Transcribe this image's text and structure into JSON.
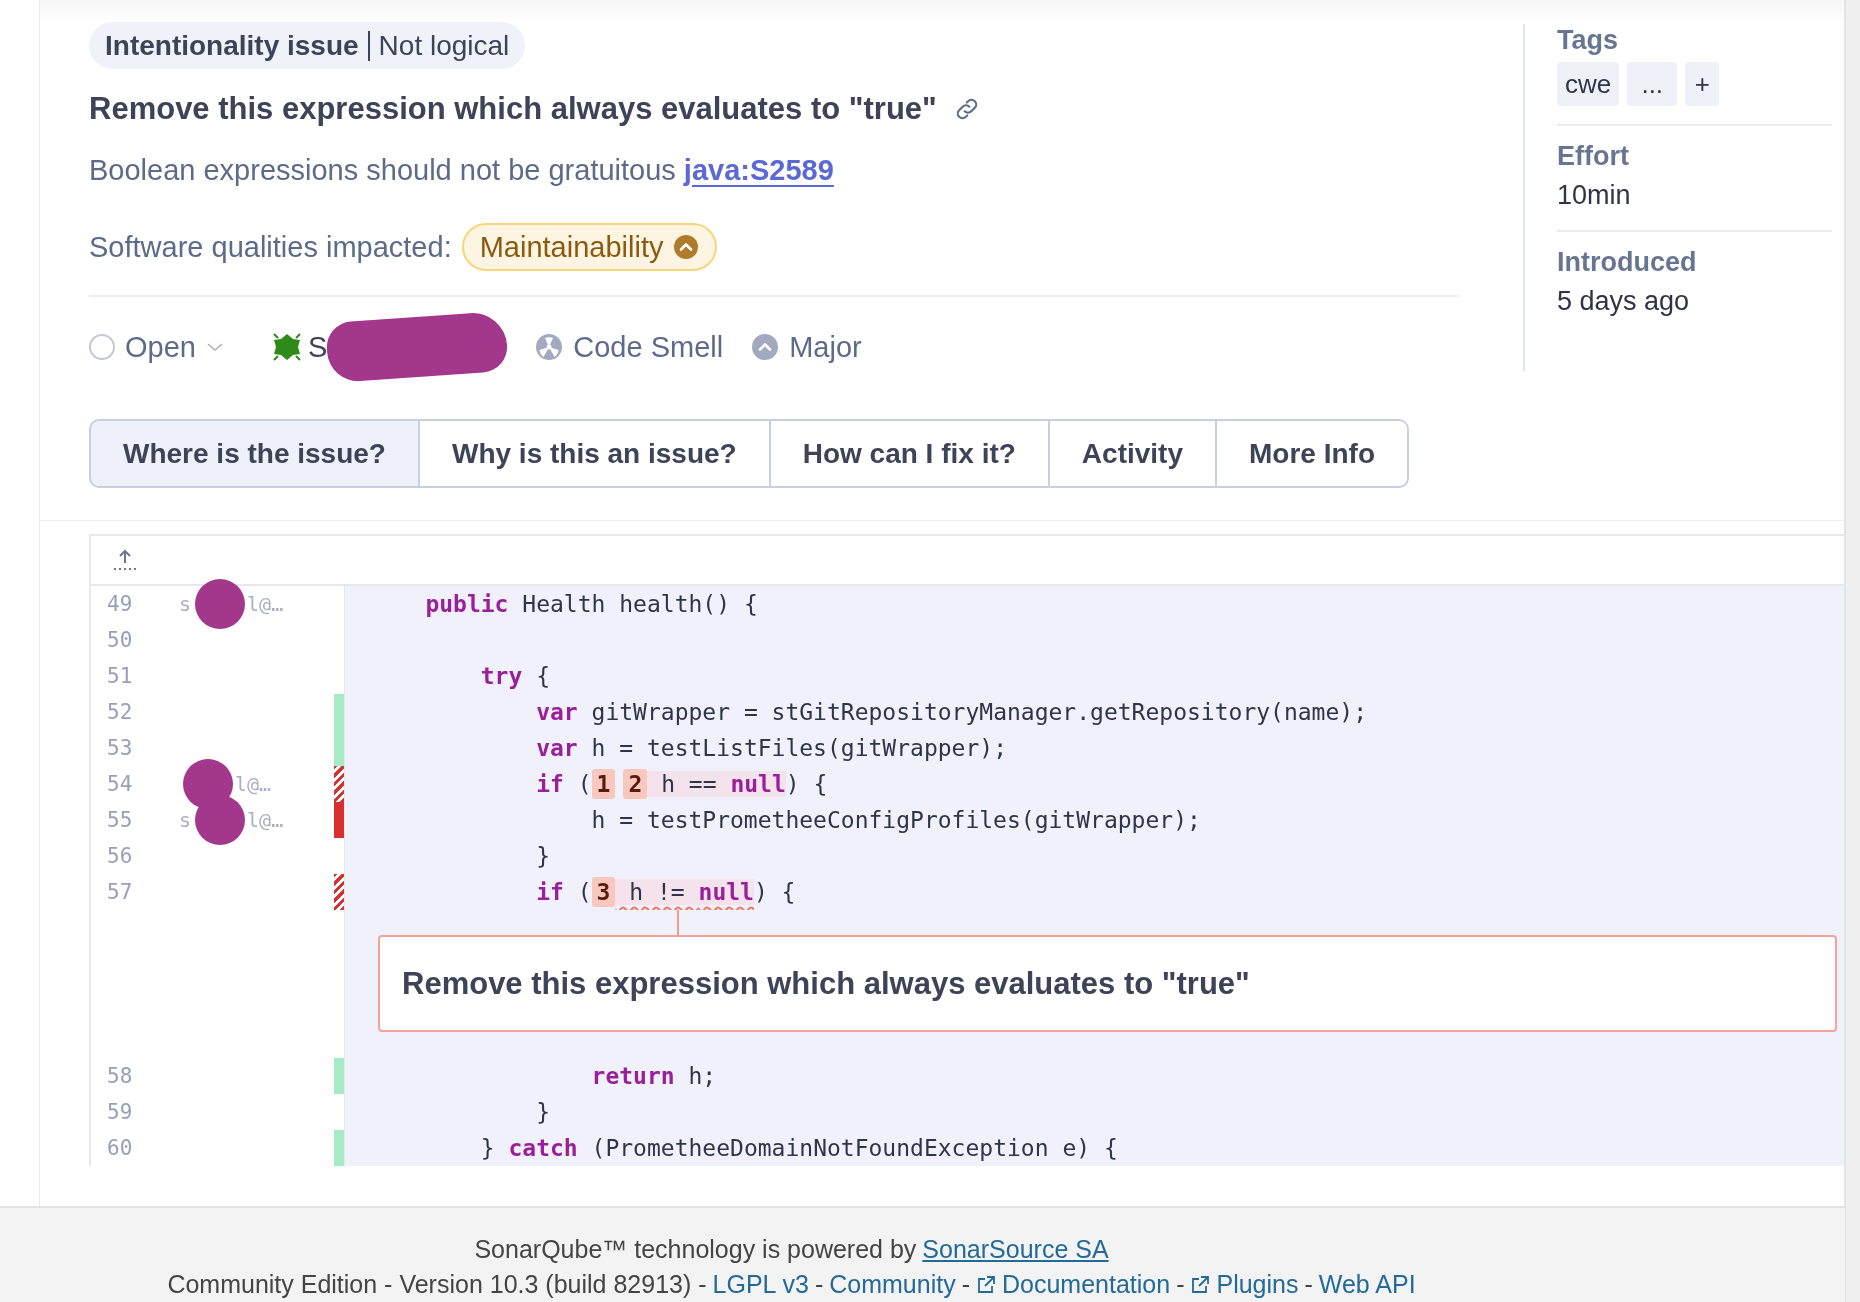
{
  "issue": {
    "attribute": "Intentionality issue",
    "category": "Not logical",
    "title": "Remove this expression which always evaluates to \"true\"",
    "rule": {
      "text": "Boolean expressions should not be gratuitous",
      "link": "java:S2589"
    },
    "qualities": {
      "label": "Software qualities impacted:",
      "items": [
        "Maintainability"
      ]
    },
    "status": "Open",
    "assignee": {
      "text": "S",
      "redacted": true
    },
    "type": "Code Smell",
    "severity": "Major"
  },
  "tabs": [
    {
      "label": "Where is the issue?",
      "selected": true
    },
    {
      "label": "Why is this an issue?",
      "selected": false
    },
    {
      "label": "How can I fix it?",
      "selected": false
    },
    {
      "label": "Activity",
      "selected": false
    },
    {
      "label": "More Info",
      "selected": false
    }
  ],
  "sidebar": {
    "tags": {
      "label": "Tags",
      "items": [
        "cwe",
        "..."
      ],
      "add": "+"
    },
    "fields": [
      {
        "label": "Effort",
        "value": "10min"
      },
      {
        "label": "Introduced",
        "value": "5 days ago"
      }
    ]
  },
  "code": {
    "rows": [
      {
        "kind": "line",
        "number": "49",
        "author": [
          "s",
          "l@…"
        ],
        "redacted": true,
        "tokens": [
          {
            "kind": "kw",
            "text": "    public"
          },
          {
            "kind": "txt",
            "text": " Health health() {"
          }
        ]
      },
      {
        "kind": "line",
        "number": "50",
        "author": [],
        "redacted": false,
        "tokens": []
      },
      {
        "kind": "line",
        "number": "51",
        "author": [],
        "redacted": false,
        "tokens": [
          {
            "kind": "kw",
            "text": "        try"
          },
          {
            "kind": "txt",
            "text": " {"
          }
        ]
      },
      {
        "kind": "line",
        "number": "52",
        "author": [],
        "redacted": false,
        "covered": true,
        "partial": false,
        "tokens": [
          {
            "kind": "kw",
            "text": "            var"
          },
          {
            "kind": "txt",
            "text": " gitWrapper = stGitRepositoryManager.getRepository(name);"
          }
        ]
      },
      {
        "kind": "line",
        "number": "53",
        "author": [],
        "redacted": false,
        "covered": true,
        "partial": false,
        "tokens": [
          {
            "kind": "kw",
            "text": "            var"
          },
          {
            "kind": "txt",
            "text": " h = testListFiles(gitWrapper);"
          }
        ]
      },
      {
        "kind": "line",
        "number": "54",
        "author": [
          "l@…"
        ],
        "redacted": true,
        "covered": false,
        "partial": true,
        "tokens": [
          {
            "kind": "kw",
            "text": "            if"
          },
          {
            "kind": "txt",
            "text": " ("
          },
          {
            "kind": "loc",
            "text": "1"
          },
          {
            "kind": "loc",
            "text": "2"
          },
          {
            "kind": "hl_txt",
            "text": " h == "
          },
          {
            "kind": "hl_kw",
            "text": "null"
          },
          {
            "kind": "txt",
            "text": ") {"
          }
        ]
      },
      {
        "kind": "line",
        "number": "55",
        "author": [
          "s",
          "l@…"
        ],
        "redacted": true,
        "covered": false,
        "partial": false,
        "tokens": [
          {
            "kind": "txt",
            "text": "                h = testPrometheeConfigProfiles(gitWrapper);"
          }
        ]
      },
      {
        "kind": "line",
        "number": "56",
        "author": [],
        "redacted": false,
        "tokens": [
          {
            "kind": "txt",
            "text": "            }"
          }
        ]
      },
      {
        "kind": "line",
        "number": "57",
        "author": [],
        "redacted": false,
        "covered": false,
        "partial": true,
        "tokens": [
          {
            "kind": "kw",
            "text": "            if"
          },
          {
            "kind": "txt",
            "text": " ("
          },
          {
            "kind": "loc",
            "text": "3"
          },
          {
            "kind": "err_txt",
            "text": " h != "
          },
          {
            "kind": "err_kw",
            "text": "null"
          },
          {
            "kind": "txt",
            "text": ") {"
          }
        ]
      },
      {
        "kind": "message",
        "text": "Remove this expression which always evaluates to \"true\""
      },
      {
        "kind": "line",
        "number": "58",
        "author": [],
        "redacted": false,
        "covered": true,
        "partial": false,
        "tokens": [
          {
            "kind": "kw",
            "text": "                return"
          },
          {
            "kind": "txt",
            "text": " h;"
          }
        ]
      },
      {
        "kind": "line",
        "number": "59",
        "author": [],
        "redacted": false,
        "tokens": [
          {
            "kind": "txt",
            "text": "            }"
          }
        ]
      },
      {
        "kind": "line",
        "number": "60",
        "author": [],
        "redacted": false,
        "covered": true,
        "partial": false,
        "tokens": [
          {
            "kind": "txt",
            "text": "        } "
          },
          {
            "kind": "kw",
            "text": "catch"
          },
          {
            "kind": "txt",
            "text": " (PrometheeDomainNotFoundException e) {"
          }
        ]
      }
    ]
  },
  "footer": {
    "lines": [
      [
        {
          "kind": "text",
          "text": "SonarQube™ technology is powered by"
        },
        {
          "kind": "link",
          "text": "SonarSource SA"
        }
      ],
      [
        {
          "kind": "text",
          "text": "Community Edition - Version 10.3 (build 82913) -"
        },
        {
          "kind": "plainlink",
          "text": "LGPL v3"
        },
        {
          "kind": "text",
          "text": "-"
        },
        {
          "kind": "plainlink",
          "text": "Community"
        },
        {
          "kind": "text",
          "text": "-"
        },
        {
          "kind": "external",
          "text": "Documentation"
        },
        {
          "kind": "text",
          "text": "-"
        },
        {
          "kind": "external",
          "text": "Plugins"
        },
        {
          "kind": "text",
          "text": "-"
        },
        {
          "kind": "plainlink",
          "text": "Web API"
        }
      ]
    ]
  }
}
